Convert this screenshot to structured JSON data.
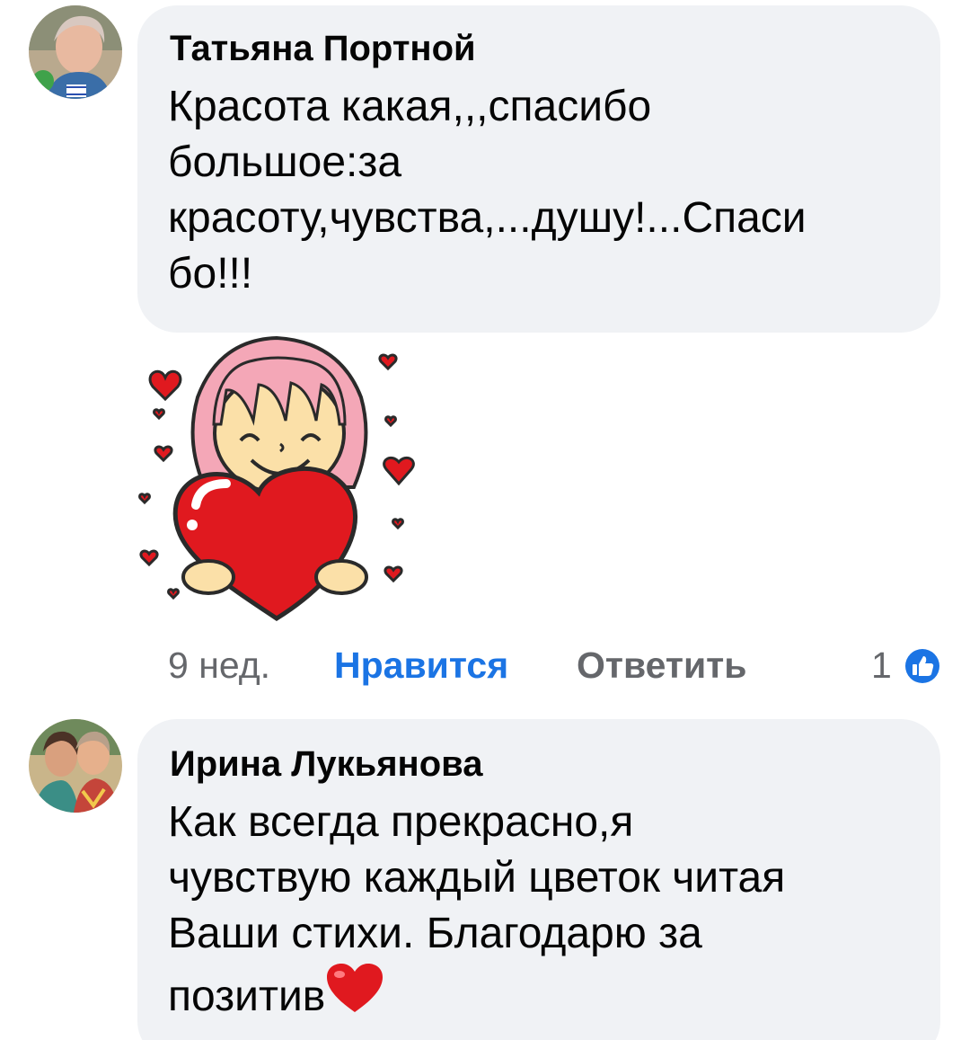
{
  "comments": [
    {
      "author": "Татьяна Портной",
      "text": "Красота какая,,,спасибо\nбольшое:за\nкрасоту,чувства,...душу!...Спаси\nбо!!!",
      "avatar_icon": "user-avatar-photo"
    },
    {
      "author": "Ирина Лукьянова",
      "text": "Как всегда прекрасно,я\nчувствую каждый цветок читая\nВаши стихи. Благодарю за\nпозитив",
      "avatar_icon": "user-avatar-photo"
    }
  ],
  "sticker": {
    "icon": "girl-holding-heart-sticker"
  },
  "actions": {
    "time": "9 нед.",
    "like_label": "Нравится",
    "reply_label": "Ответить",
    "reaction_count": "1",
    "reaction_icon": "thumbs-up-icon"
  },
  "colors": {
    "accent": "#1b74e4",
    "bubble": "#f0f2f5",
    "secondary_text": "#65676b",
    "heart": "#e0191f"
  }
}
